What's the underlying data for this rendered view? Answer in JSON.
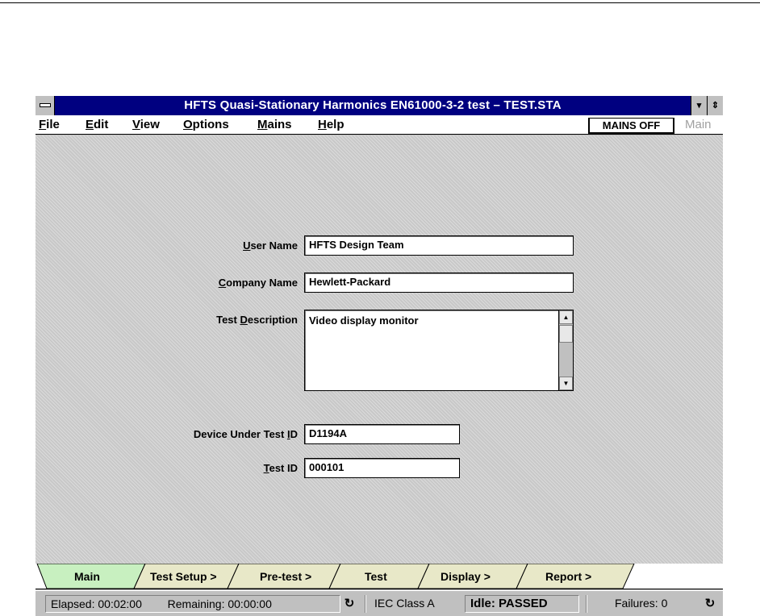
{
  "window": {
    "title": "HFTS Quasi-Stationary Harmonics EN61000-3-2 test – TEST.STA",
    "minimize_glyph": "▾",
    "restore_glyph": "⇕"
  },
  "menu": {
    "file_key": "F",
    "file_rest": "ile",
    "edit_key": "E",
    "edit_rest": "dit",
    "view_key": "V",
    "view_rest": "iew",
    "options_key": "O",
    "options_rest": "ptions",
    "mains_key": "M",
    "mains_rest": "ains",
    "help_key": "H",
    "help_rest": "elp",
    "mains_status": "MAINS OFF",
    "current_page": "Main"
  },
  "form": {
    "user_name": {
      "label_key": "U",
      "label_rest": "ser Name",
      "value": "HFTS Design Team"
    },
    "company_name": {
      "label_key": "C",
      "label_rest": "ompany Name",
      "value": "Hewlett-Packard"
    },
    "test_description": {
      "label_pre": "Test ",
      "label_key": "D",
      "label_rest": "escription",
      "value": "Video display monitor"
    },
    "device_id": {
      "label_pre": "Device Under Test ",
      "label_key": "I",
      "label_rest": "D",
      "value": "D1194A"
    },
    "test_id": {
      "label_key": "T",
      "label_rest": "est ID",
      "value": "000101"
    }
  },
  "tabs": [
    {
      "label": "Main",
      "active": true
    },
    {
      "label": "Test Setup >",
      "active": false
    },
    {
      "label": "Pre-test >",
      "active": false
    },
    {
      "label": "Test",
      "active": false
    },
    {
      "label": "Display >",
      "active": false
    },
    {
      "label": "Report >",
      "active": false
    }
  ],
  "status": {
    "elapsed": "Elapsed: 00:02:00",
    "remaining": "Remaining: 00:00:00",
    "refresh_glyph": "↻",
    "device_class": "IEC Class A",
    "state": "Idle: PASSED",
    "failures": "Failures: 0"
  },
  "colors": {
    "title_bar": "#000080",
    "active_tab": "#c8f0c0",
    "inactive_tab": "#e8e8c8",
    "background": "#c0c0c0"
  }
}
